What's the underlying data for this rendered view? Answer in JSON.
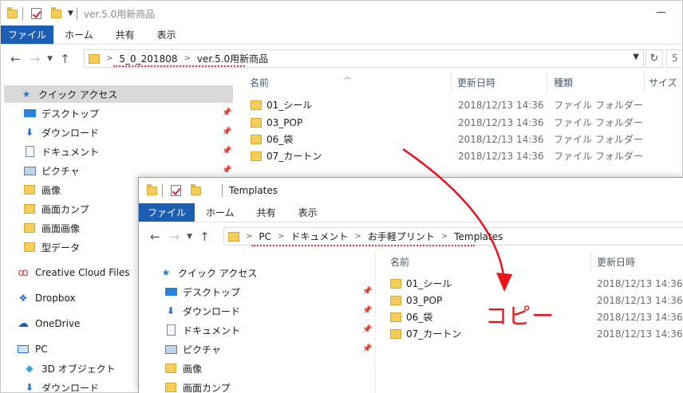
{
  "back_window": {
    "title": "ver.5.0用新商品",
    "ribbon_tabs": [
      "ファイル",
      "ホーム",
      "共有",
      "表示"
    ],
    "breadcrumb": [
      "5_0_201808",
      "ver.5.0用新商品"
    ],
    "search_placeholder": "5",
    "columns": [
      "名前",
      "更新日時",
      "種類",
      "サイズ"
    ],
    "nav_items": [
      {
        "label": "クイック アクセス",
        "icon": "star-icon"
      },
      {
        "label": "デスクトップ",
        "icon": "desktop-icon",
        "pinned": true
      },
      {
        "label": "ダウンロード",
        "icon": "download-icon",
        "pinned": true
      },
      {
        "label": "ドキュメント",
        "icon": "document-icon",
        "pinned": true
      },
      {
        "label": "ピクチャ",
        "icon": "picture-icon",
        "pinned": true
      },
      {
        "label": "画像",
        "icon": "folder-icon"
      },
      {
        "label": "画面カンプ",
        "icon": "folder-icon"
      },
      {
        "label": "画面画像",
        "icon": "folder-icon"
      },
      {
        "label": "型データ",
        "icon": "folder-icon"
      },
      {
        "label": "Creative Cloud Files",
        "icon": "creative-cloud-icon"
      },
      {
        "label": "Dropbox",
        "icon": "dropbox-icon"
      },
      {
        "label": "OneDrive",
        "icon": "onedrive-icon"
      },
      {
        "label": "PC",
        "icon": "pc-icon"
      },
      {
        "label": "3D オブジェクト",
        "icon": "3d-objects-icon"
      },
      {
        "label": "ダウンロード",
        "icon": "download-icon"
      }
    ],
    "files": [
      {
        "name": "01_シール",
        "date": "2018/12/13 14:36",
        "kind": "ファイル フォルダー"
      },
      {
        "name": "03_POP",
        "date": "2018/12/13 14:36",
        "kind": "ファイル フォルダー"
      },
      {
        "name": "06_袋",
        "date": "2018/12/13 14:36",
        "kind": "ファイル フォルダー"
      },
      {
        "name": "07_カートン",
        "date": "2018/12/13 14:36",
        "kind": "ファイル フォルダー"
      }
    ]
  },
  "front_window": {
    "title": "Templates",
    "ribbon_tabs": [
      "ファイル",
      "ホーム",
      "共有",
      "表示"
    ],
    "breadcrumb": [
      "PC",
      "ドキュメント",
      "お手軽プリント",
      "Templates"
    ],
    "columns": [
      "名前",
      "更新日時"
    ],
    "nav_items": [
      {
        "label": "クイック アクセス",
        "icon": "star-icon"
      },
      {
        "label": "デスクトップ",
        "icon": "desktop-icon",
        "pinned": true
      },
      {
        "label": "ダウンロード",
        "icon": "download-icon",
        "pinned": true
      },
      {
        "label": "ドキュメント",
        "icon": "document-icon",
        "pinned": true
      },
      {
        "label": "ピクチャ",
        "icon": "picture-icon",
        "pinned": true
      },
      {
        "label": "画像",
        "icon": "folder-icon"
      },
      {
        "label": "画面カンプ",
        "icon": "folder-icon"
      }
    ],
    "files": [
      {
        "name": "01_シール",
        "date": "2018/12/13 14:36"
      },
      {
        "name": "03_POP",
        "date": "2018/12/13 14:36"
      },
      {
        "name": "06_袋",
        "date": "2018/12/13 14:36"
      },
      {
        "name": "07_カートン",
        "date": "2018/12/13 14:36"
      }
    ]
  },
  "annotation": {
    "label": "コピー",
    "color": "#e8141b"
  },
  "colors": {
    "file_tab": "#1a5fb4",
    "folder": "#f5cd5b",
    "selection": "#d9d9d9"
  }
}
